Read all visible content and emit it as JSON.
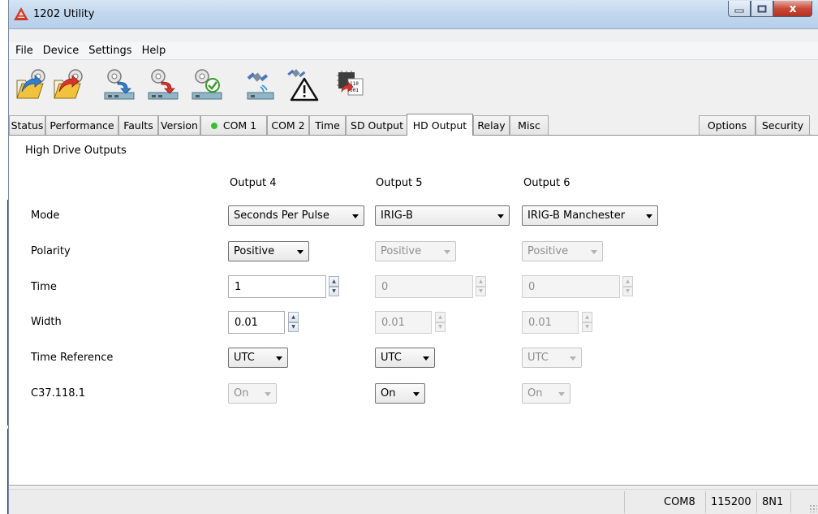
{
  "window": {
    "title": "1202 Utility",
    "controls": {
      "minimize": "—",
      "maximize": "☐",
      "close": "x"
    }
  },
  "menu": [
    "File",
    "Device",
    "Settings",
    "Help"
  ],
  "toolbar": {
    "buttons": [
      "open-settings-icon",
      "open-defaults-icon",
      "read-device-icon",
      "write-device-icon",
      "verify-device-icon",
      "gps-receiver-icon",
      "gps-alarm-icon",
      "firmware-update-icon"
    ]
  },
  "tabs": [
    "Status",
    "Performance",
    "Faults",
    "Version",
    "COM 1",
    "COM 2",
    "Time",
    "SD Output",
    "HD Output",
    "Relay",
    "Misc",
    "Options",
    "Security"
  ],
  "active_tab": "HD Output",
  "com1_status_color": "#3cbe32",
  "panel": {
    "heading": "High Drive Outputs",
    "columns": [
      "Output 4",
      "Output 5",
      "Output 6"
    ],
    "rows": [
      "Mode",
      "Polarity",
      "Time",
      "Width",
      "Time Reference",
      "C37.118.1"
    ],
    "outputs": [
      {
        "mode": "Seconds Per Pulse",
        "polarity": "Positive",
        "time": "1",
        "width": "0.01",
        "time_reference": "UTC",
        "c37": "On"
      },
      {
        "mode": "IRIG-B",
        "polarity": "Positive",
        "time": "0",
        "width": "0.01",
        "time_reference": "UTC",
        "c37": "On"
      },
      {
        "mode": "IRIG-B Manchester",
        "polarity": "Positive",
        "time": "0",
        "width": "0.01",
        "time_reference": "UTC",
        "c37": "On"
      }
    ]
  },
  "statusbar": {
    "port": "COM8",
    "baud": "115200",
    "format": "8N1"
  }
}
